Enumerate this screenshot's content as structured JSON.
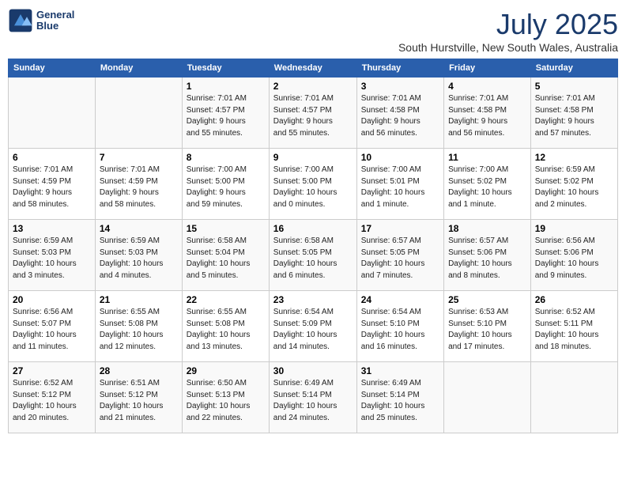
{
  "header": {
    "logo_line1": "General",
    "logo_line2": "Blue",
    "month": "July 2025",
    "location": "South Hurstville, New South Wales, Australia"
  },
  "weekdays": [
    "Sunday",
    "Monday",
    "Tuesday",
    "Wednesday",
    "Thursday",
    "Friday",
    "Saturday"
  ],
  "weeks": [
    [
      {
        "day": "",
        "info": ""
      },
      {
        "day": "",
        "info": ""
      },
      {
        "day": "1",
        "info": "Sunrise: 7:01 AM\nSunset: 4:57 PM\nDaylight: 9 hours\nand 55 minutes."
      },
      {
        "day": "2",
        "info": "Sunrise: 7:01 AM\nSunset: 4:57 PM\nDaylight: 9 hours\nand 55 minutes."
      },
      {
        "day": "3",
        "info": "Sunrise: 7:01 AM\nSunset: 4:58 PM\nDaylight: 9 hours\nand 56 minutes."
      },
      {
        "day": "4",
        "info": "Sunrise: 7:01 AM\nSunset: 4:58 PM\nDaylight: 9 hours\nand 56 minutes."
      },
      {
        "day": "5",
        "info": "Sunrise: 7:01 AM\nSunset: 4:58 PM\nDaylight: 9 hours\nand 57 minutes."
      }
    ],
    [
      {
        "day": "6",
        "info": "Sunrise: 7:01 AM\nSunset: 4:59 PM\nDaylight: 9 hours\nand 58 minutes."
      },
      {
        "day": "7",
        "info": "Sunrise: 7:01 AM\nSunset: 4:59 PM\nDaylight: 9 hours\nand 58 minutes."
      },
      {
        "day": "8",
        "info": "Sunrise: 7:00 AM\nSunset: 5:00 PM\nDaylight: 9 hours\nand 59 minutes."
      },
      {
        "day": "9",
        "info": "Sunrise: 7:00 AM\nSunset: 5:00 PM\nDaylight: 10 hours\nand 0 minutes."
      },
      {
        "day": "10",
        "info": "Sunrise: 7:00 AM\nSunset: 5:01 PM\nDaylight: 10 hours\nand 1 minute."
      },
      {
        "day": "11",
        "info": "Sunrise: 7:00 AM\nSunset: 5:02 PM\nDaylight: 10 hours\nand 1 minute."
      },
      {
        "day": "12",
        "info": "Sunrise: 6:59 AM\nSunset: 5:02 PM\nDaylight: 10 hours\nand 2 minutes."
      }
    ],
    [
      {
        "day": "13",
        "info": "Sunrise: 6:59 AM\nSunset: 5:03 PM\nDaylight: 10 hours\nand 3 minutes."
      },
      {
        "day": "14",
        "info": "Sunrise: 6:59 AM\nSunset: 5:03 PM\nDaylight: 10 hours\nand 4 minutes."
      },
      {
        "day": "15",
        "info": "Sunrise: 6:58 AM\nSunset: 5:04 PM\nDaylight: 10 hours\nand 5 minutes."
      },
      {
        "day": "16",
        "info": "Sunrise: 6:58 AM\nSunset: 5:05 PM\nDaylight: 10 hours\nand 6 minutes."
      },
      {
        "day": "17",
        "info": "Sunrise: 6:57 AM\nSunset: 5:05 PM\nDaylight: 10 hours\nand 7 minutes."
      },
      {
        "day": "18",
        "info": "Sunrise: 6:57 AM\nSunset: 5:06 PM\nDaylight: 10 hours\nand 8 minutes."
      },
      {
        "day": "19",
        "info": "Sunrise: 6:56 AM\nSunset: 5:06 PM\nDaylight: 10 hours\nand 9 minutes."
      }
    ],
    [
      {
        "day": "20",
        "info": "Sunrise: 6:56 AM\nSunset: 5:07 PM\nDaylight: 10 hours\nand 11 minutes."
      },
      {
        "day": "21",
        "info": "Sunrise: 6:55 AM\nSunset: 5:08 PM\nDaylight: 10 hours\nand 12 minutes."
      },
      {
        "day": "22",
        "info": "Sunrise: 6:55 AM\nSunset: 5:08 PM\nDaylight: 10 hours\nand 13 minutes."
      },
      {
        "day": "23",
        "info": "Sunrise: 6:54 AM\nSunset: 5:09 PM\nDaylight: 10 hours\nand 14 minutes."
      },
      {
        "day": "24",
        "info": "Sunrise: 6:54 AM\nSunset: 5:10 PM\nDaylight: 10 hours\nand 16 minutes."
      },
      {
        "day": "25",
        "info": "Sunrise: 6:53 AM\nSunset: 5:10 PM\nDaylight: 10 hours\nand 17 minutes."
      },
      {
        "day": "26",
        "info": "Sunrise: 6:52 AM\nSunset: 5:11 PM\nDaylight: 10 hours\nand 18 minutes."
      }
    ],
    [
      {
        "day": "27",
        "info": "Sunrise: 6:52 AM\nSunset: 5:12 PM\nDaylight: 10 hours\nand 20 minutes."
      },
      {
        "day": "28",
        "info": "Sunrise: 6:51 AM\nSunset: 5:12 PM\nDaylight: 10 hours\nand 21 minutes."
      },
      {
        "day": "29",
        "info": "Sunrise: 6:50 AM\nSunset: 5:13 PM\nDaylight: 10 hours\nand 22 minutes."
      },
      {
        "day": "30",
        "info": "Sunrise: 6:49 AM\nSunset: 5:14 PM\nDaylight: 10 hours\nand 24 minutes."
      },
      {
        "day": "31",
        "info": "Sunrise: 6:49 AM\nSunset: 5:14 PM\nDaylight: 10 hours\nand 25 minutes."
      },
      {
        "day": "",
        "info": ""
      },
      {
        "day": "",
        "info": ""
      }
    ]
  ]
}
